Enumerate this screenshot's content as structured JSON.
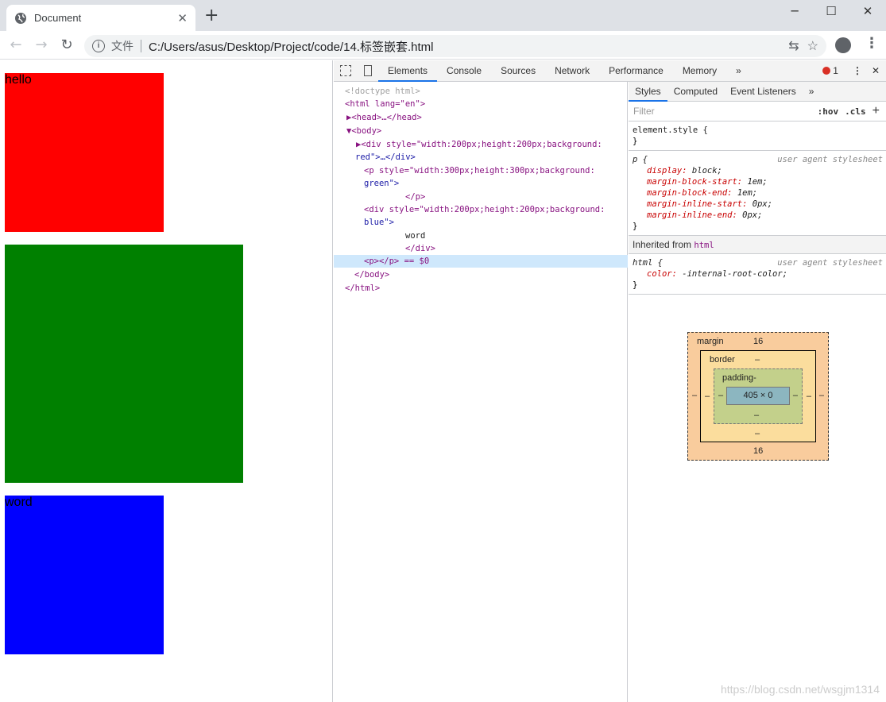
{
  "browser": {
    "tab_title": "Document",
    "tab_close": "✕",
    "new_tab": "+",
    "file_label": "文件",
    "url": "C:/Users/asus/Desktop/Project/code/14.标签嵌套.html"
  },
  "page": {
    "red_box_text": "hello",
    "green_box_text": "",
    "blue_box_text": "word",
    "colors": {
      "red": "#ff0000",
      "green": "#008000",
      "blue": "#0000ff"
    }
  },
  "devtools": {
    "tabs": [
      "Elements",
      "Console",
      "Sources",
      "Network",
      "Performance",
      "Memory"
    ],
    "more": "»",
    "error_count": "1",
    "dom_lines": [
      "<!doctype html>",
      "<html lang=\"en\">",
      "▶<head>…</head>",
      "▼<body>",
      "▶<div style=\"width:200px;height:200px;background:",
      "red\">…</div>",
      "<p style=\"width:300px;height:300px;background:",
      "green\">",
      "</p>",
      "<div style=\"width:200px;height:200px;background:",
      "blue\">",
      "word",
      "</div>",
      "<p></p> == $0",
      "</body>",
      "</html>"
    ],
    "styles_tabs": [
      "Styles",
      "Computed",
      "Event Listeners"
    ],
    "filter_placeholder": "Filter",
    "hov": ":hov",
    "cls": ".cls",
    "element_style": "element.style {",
    "rule_p": {
      "selector": "p {",
      "source": "user agent stylesheet",
      "props": [
        [
          "display",
          "block;"
        ],
        [
          "margin-block-start",
          "1em;"
        ],
        [
          "margin-block-end",
          "1em;"
        ],
        [
          "margin-inline-start",
          "0px;"
        ],
        [
          "margin-inline-end",
          "0px;"
        ]
      ]
    },
    "inherited_label": "Inherited from",
    "inherited_from": "html",
    "rule_html": {
      "selector": "html {",
      "source": "user agent stylesheet",
      "props": [
        [
          "color",
          "-internal-root-color;"
        ]
      ]
    },
    "box_model": {
      "margin_label": "margin",
      "margin_top": "16",
      "margin_bottom": "16",
      "border_label": "border",
      "padding_label": "padding-",
      "content": "405 × 0",
      "dash": "–"
    }
  },
  "watermark": "https://blog.csdn.net/wsgjm1314"
}
